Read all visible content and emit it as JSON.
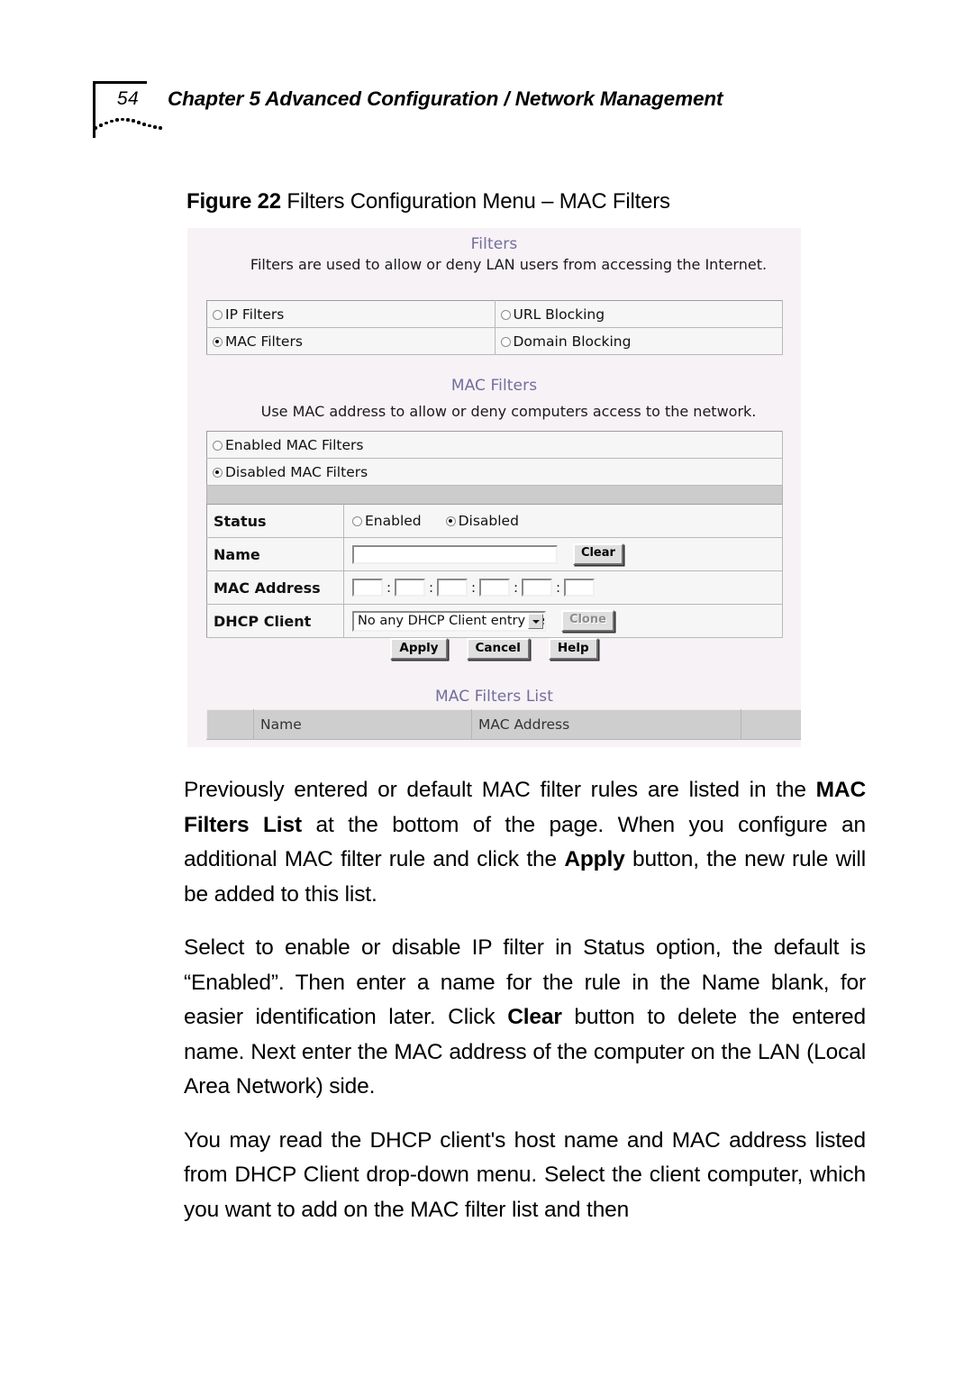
{
  "header": {
    "page_number": "54",
    "chapter_title": "Chapter 5 Advanced Configuration / Network Management"
  },
  "figure": {
    "label": "Figure 22",
    "title": " Filters Configuration Menu – MAC Filters"
  },
  "ui": {
    "filters_heading": "Filters",
    "filters_description": "Filters are used to allow or deny LAN users from accessing the Internet.",
    "filter_modes": [
      {
        "label": "IP Filters",
        "selected": false
      },
      {
        "label": "URL Blocking",
        "selected": false
      },
      {
        "label": "MAC Filters",
        "selected": true
      },
      {
        "label": "Domain Blocking",
        "selected": false
      }
    ],
    "mac_heading": "MAC Filters",
    "mac_description": "Use MAC address to allow or deny computers access to the network.",
    "mac_modes": [
      {
        "label": "Enabled MAC Filters",
        "selected": false
      },
      {
        "label": "Disabled MAC Filters",
        "selected": true
      }
    ],
    "form": {
      "status_label": "Status",
      "status_options": [
        {
          "label": "Enabled",
          "selected": false
        },
        {
          "label": "Disabled",
          "selected": true
        }
      ],
      "name_label": "Name",
      "name_value": "",
      "clear_button": "Clear",
      "mac_address_label": "MAC Address",
      "mac_octets": [
        "",
        "",
        "",
        "",
        "",
        ""
      ],
      "mac_separator": ":",
      "dhcp_client_label": "DHCP Client",
      "dhcp_client_selected": "No any DHCP Client entry yet",
      "clone_button": "Clone"
    },
    "actions": {
      "apply": "Apply",
      "cancel": "Cancel",
      "help": "Help"
    },
    "list": {
      "heading": "MAC Filters List",
      "columns": [
        "",
        "Name",
        "MAC Address",
        ""
      ],
      "rows": []
    },
    "colors": {
      "heading_purple": "#726e9c",
      "panel_background": "#f7f2f5",
      "separator_gray": "#cccccc",
      "list_header_gray": "#cecece"
    }
  },
  "body": {
    "paragraphs": [
      {
        "runs": [
          {
            "text": "Previously entered or default MAC filter rules are listed in the ",
            "bold": false
          },
          {
            "text": "MAC Filters List",
            "bold": true
          },
          {
            "text": " at the bottom of the page. When you configure an additional MAC filter rule and click the ",
            "bold": false
          },
          {
            "text": "Apply",
            "bold": true
          },
          {
            "text": " button, the new rule will be added to this list.",
            "bold": false
          }
        ]
      },
      {
        "runs": [
          {
            "text": "Select to enable or disable IP filter in Status option, the default is “Enabled”. Then enter a name for the rule in the Name blank, for easier identification later. Click ",
            "bold": false
          },
          {
            "text": "Clear",
            "bold": true
          },
          {
            "text": " button to delete the entered name. Next enter the MAC address of the computer on the LAN (Local Area Network) side.",
            "bold": false
          }
        ]
      },
      {
        "runs": [
          {
            "text": "You may read the DHCP client's host name and MAC address listed from DHCP Client drop-down menu. Select the client computer, which you want to add on the MAC filter list and then",
            "bold": false
          }
        ]
      }
    ]
  }
}
